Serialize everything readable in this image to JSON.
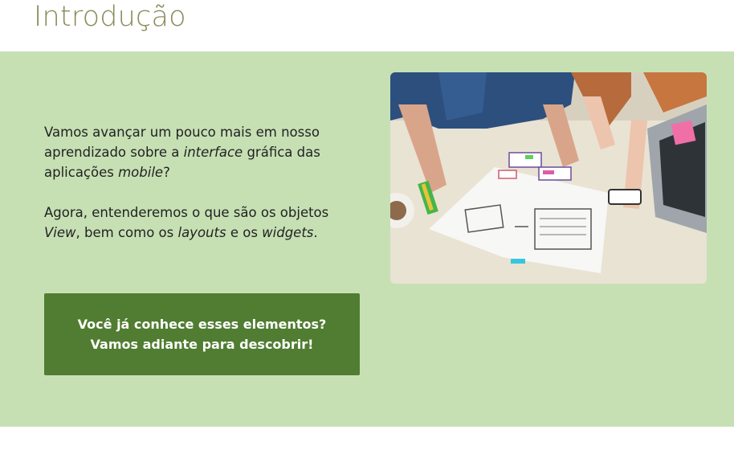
{
  "page": {
    "title": "Introdução"
  },
  "intro": {
    "p1_part1": "Vamos avançar um pouco mais em nosso aprendizado sobre a ",
    "p1_em1": "interface",
    "p1_part2": " gráfica das aplicações ",
    "p1_em2": "mobile",
    "p1_part3": "?",
    "p2_part1": "Agora, entenderemos o que são os objetos ",
    "p2_em1": "View",
    "p2_part2": ", bem como os ",
    "p2_em2": "layouts",
    "p2_part3": " e os ",
    "p2_em3": "widgets",
    "p2_part4": "."
  },
  "cta": {
    "line1": "Você já conhece esses elementos?",
    "line2": "Vamos adiante para descobrir!"
  },
  "colors": {
    "panel_background": "#c6e0b4",
    "button_background": "#507d31",
    "title_color": "#8a8a5a"
  },
  "image": {
    "subject": "photo"
  }
}
